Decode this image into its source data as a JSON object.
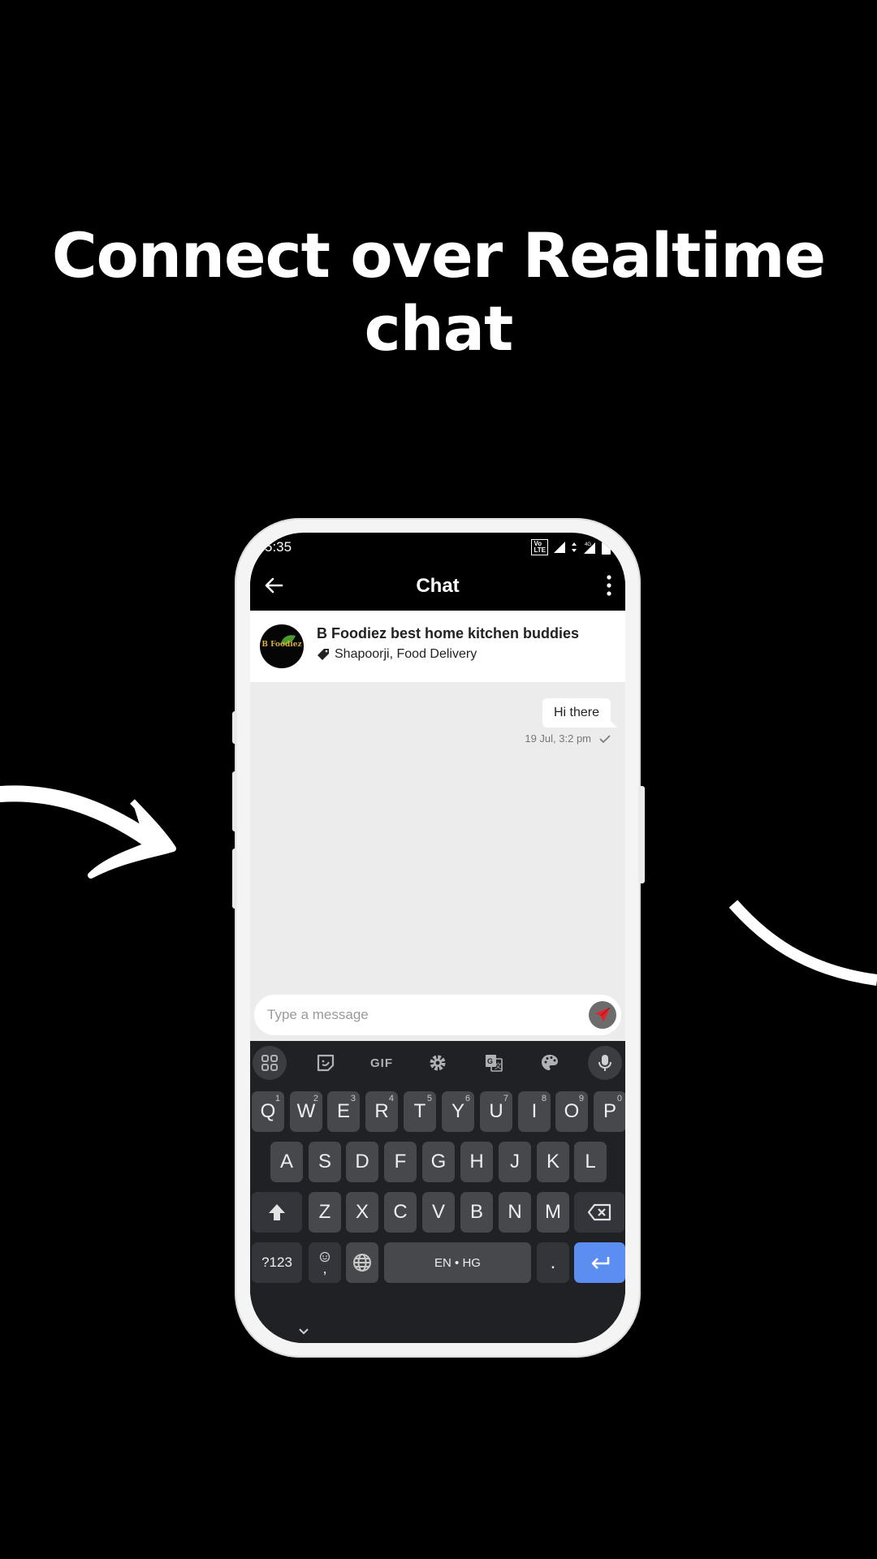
{
  "headline": {
    "line1": "Connect over Realtime",
    "line2": "chat"
  },
  "status_bar": {
    "time": "5:35",
    "network_badge": "VoLTE",
    "network_badge_sub": "LTE 2",
    "network_type": "4G",
    "icons": [
      "volte-icon",
      "signal-icon",
      "data-arrows-icon",
      "signal-roaming-icon",
      "battery-icon"
    ]
  },
  "app_bar": {
    "title": "Chat",
    "back_icon": "arrow-back-icon",
    "menu_icon": "more-vert-icon"
  },
  "chat_header": {
    "avatar_text": "B Foodiez",
    "name": "B Foodiez best home kitchen buddies",
    "subtitle": "Shapoorji, Food Delivery",
    "subtitle_icon": "tag-icon"
  },
  "messages": [
    {
      "text": "Hi there",
      "time": "19 Jul, 3:2 pm",
      "status": "sent",
      "direction": "outgoing"
    }
  ],
  "composer": {
    "placeholder": "Type a message",
    "value": "",
    "send_icon": "send-icon"
  },
  "colors": {
    "send_icon": "#e8212a",
    "enter_key": "#5c8ef2",
    "keyboard_bg": "#202124",
    "messages_bg": "#ececec"
  },
  "keyboard": {
    "toolbar": [
      {
        "name": "apps-grid-icon"
      },
      {
        "name": "sticker-icon"
      },
      {
        "name": "gif-button",
        "label": "GIF"
      },
      {
        "name": "settings-icon"
      },
      {
        "name": "translate-icon"
      },
      {
        "name": "palette-icon"
      },
      {
        "name": "mic-icon"
      }
    ],
    "row1": [
      {
        "k": "Q",
        "n": "1"
      },
      {
        "k": "W",
        "n": "2"
      },
      {
        "k": "E",
        "n": "3"
      },
      {
        "k": "R",
        "n": "4"
      },
      {
        "k": "T",
        "n": "5"
      },
      {
        "k": "Y",
        "n": "6"
      },
      {
        "k": "U",
        "n": "7"
      },
      {
        "k": "I",
        "n": "8"
      },
      {
        "k": "O",
        "n": "9"
      },
      {
        "k": "P",
        "n": "0"
      }
    ],
    "row2": [
      "A",
      "S",
      "D",
      "F",
      "G",
      "H",
      "J",
      "K",
      "L"
    ],
    "row3": [
      "Z",
      "X",
      "C",
      "V",
      "B",
      "N",
      "M"
    ],
    "row4": {
      "symbols": "?123",
      "comma": ",",
      "space": "EN • HG",
      "period": "."
    }
  }
}
